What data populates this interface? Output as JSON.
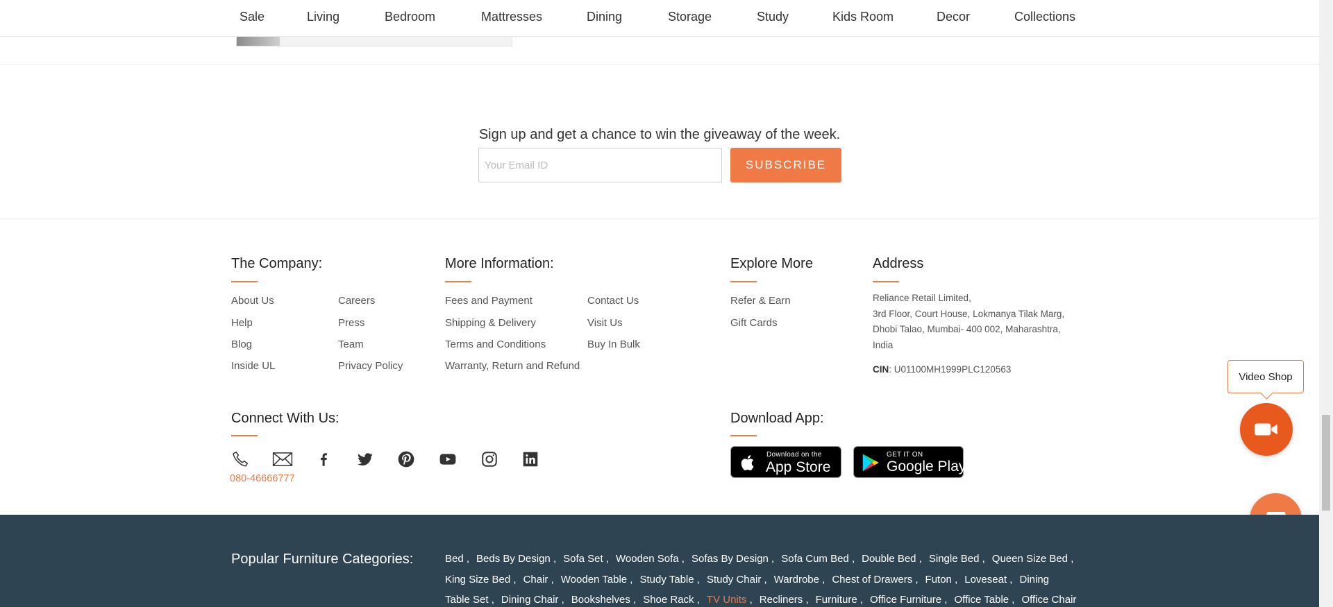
{
  "nav": {
    "items": [
      "Sale",
      "Living",
      "Bedroom",
      "Mattresses",
      "Dining",
      "Storage",
      "Study",
      "Kids Room",
      "Decor",
      "Collections"
    ]
  },
  "newsletter": {
    "text": "Sign up and get a chance to win the giveaway of the week.",
    "email_placeholder": "Your Email ID",
    "subscribe_label": "SUBSCRIBE"
  },
  "footer": {
    "company": {
      "heading": "The Company:",
      "col1": [
        "About Us",
        "Help",
        "Blog",
        "Inside UL"
      ],
      "col2": [
        "Careers",
        "Press",
        "Team",
        "Privacy Policy"
      ]
    },
    "more_info": {
      "heading": "More Information:",
      "col1": [
        "Fees and Payment",
        "Shipping & Delivery",
        "Terms and Conditions",
        "Warranty, Return and Refund"
      ],
      "col2": [
        "Contact Us",
        "Visit Us",
        "Buy In Bulk"
      ]
    },
    "explore": {
      "heading": "Explore More",
      "links": [
        "Refer & Earn",
        "Gift Cards"
      ]
    },
    "address": {
      "heading": "Address",
      "lines": [
        "Reliance Retail Limited,",
        "3rd Floor, Court House, Lokmanya Tilak Marg,",
        "Dhobi Talao, Mumbai- 400 002, Maharashtra,",
        "India"
      ],
      "cin_label": "CIN",
      "cin_value": ": U01100MH1999PLC120563"
    },
    "connect": {
      "heading": "Connect With Us:",
      "icons": [
        "phone-icon",
        "mail-icon",
        "facebook-icon",
        "twitter-icon",
        "pinterest-icon",
        "youtube-icon",
        "instagram-icon",
        "linkedin-icon"
      ],
      "phone": "080-46666777"
    },
    "download": {
      "heading": "Download App:",
      "app_store_small": "Download on the",
      "app_store_big": "App Store",
      "google_small": "GET IT ON",
      "google_big": "Google Play"
    }
  },
  "widgets": {
    "video_shop_label": "Video Shop"
  },
  "categories": {
    "heading": "Popular Furniture Categories:",
    "row1": [
      "Bed",
      "Beds By Design",
      "Sofa Set",
      "Wooden Sofa",
      "Sofas By Design",
      "Sofa Cum Bed",
      "Double Bed",
      "Single Bed",
      "Queen Size Bed"
    ],
    "row2": [
      "King Size Bed",
      "Chair",
      "Wooden Table",
      "Study Table",
      "Study Chair",
      "Wardrobe",
      "Chest of Drawers",
      "Futon",
      "Loveseat",
      "Dining"
    ],
    "row3": [
      "Table Set",
      "Dining Chair",
      "Bookshelves",
      "Shoe Rack",
      "TV Units",
      "Recliners",
      "Furniture",
      "Office Furniture",
      "Office Table",
      "Office Chair"
    ],
    "highlighted": "TV Units"
  },
  "colors": {
    "accent": "#f07a45",
    "dark_band": "#2e4453",
    "video_button": "#e8591d"
  }
}
